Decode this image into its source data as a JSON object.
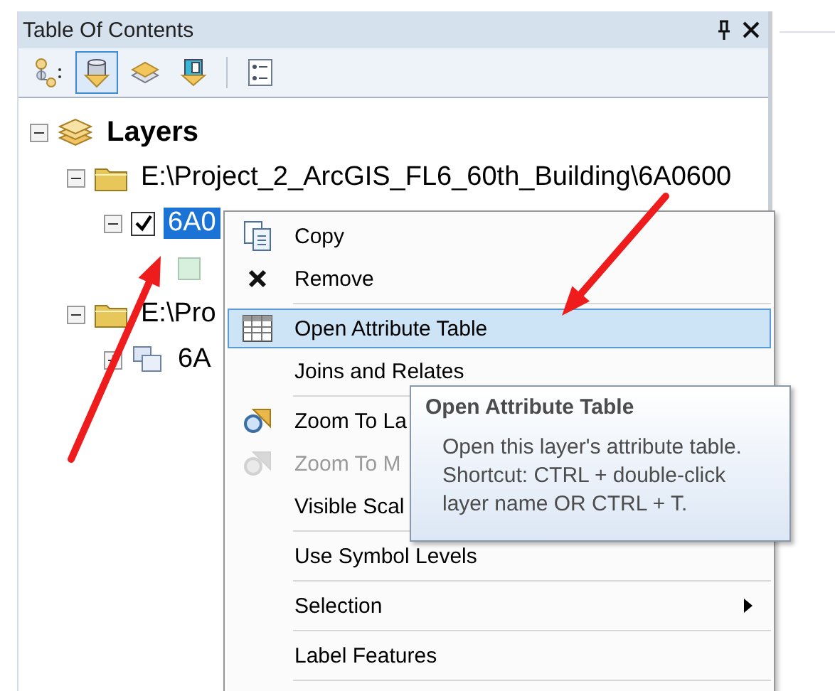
{
  "panel": {
    "title": "Table Of Contents"
  },
  "toolbar": [
    {
      "kind": "drawing-order",
      "selected": false
    },
    {
      "kind": "source",
      "selected": true
    },
    {
      "kind": "visibility",
      "selected": false
    },
    {
      "kind": "selection",
      "selected": false
    },
    {
      "kind": "options",
      "selected": false
    }
  ],
  "tree": [
    {
      "kind": "group",
      "label": "Layers",
      "expanded": true,
      "children": [
        {
          "kind": "folder",
          "label": "E:\\Project_2_ArcGIS_FL6_60th_Building\\6A0600",
          "expanded": true,
          "children": [
            {
              "kind": "layer",
              "label": "6A0",
              "expanded": true,
              "checked": true,
              "selected": true,
              "children": [
                {
                  "kind": "legend"
                }
              ]
            }
          ]
        },
        {
          "kind": "folder",
          "label": "E:\\Pro",
          "expanded": true,
          "children": [
            {
              "kind": "layergroup",
              "label": "6A",
              "expanded": false
            }
          ]
        }
      ]
    }
  ],
  "context_menu": [
    {
      "label": "Copy",
      "kind": "copy",
      "selected": false,
      "disabled": false,
      "submenu": false,
      "separator_after": false
    },
    {
      "label": "Remove",
      "kind": "remove",
      "selected": false,
      "disabled": false,
      "submenu": false,
      "separator_after": true
    },
    {
      "label": "Open Attribute Table",
      "kind": "table",
      "selected": true,
      "disabled": false,
      "submenu": false,
      "separator_after": false
    },
    {
      "label": "Joins and Relates",
      "kind": "plain",
      "selected": false,
      "disabled": false,
      "submenu": false,
      "separator_after": true
    },
    {
      "label": "Zoom To La",
      "kind": "zoom",
      "selected": false,
      "disabled": false,
      "submenu": false,
      "separator_after": false
    },
    {
      "label": "Zoom To M",
      "kind": "zoom",
      "selected": false,
      "disabled": true,
      "submenu": false,
      "separator_after": false
    },
    {
      "label": "Visible Scal",
      "kind": "plain",
      "selected": false,
      "disabled": false,
      "submenu": false,
      "separator_after": true
    },
    {
      "label": "Use Symbol Levels",
      "kind": "plain",
      "selected": false,
      "disabled": false,
      "submenu": false,
      "separator_after": true
    },
    {
      "label": "Selection",
      "kind": "plain",
      "selected": false,
      "disabled": false,
      "submenu": true,
      "separator_after": true
    },
    {
      "label": "Label Features",
      "kind": "plain",
      "selected": false,
      "disabled": false,
      "submenu": false,
      "separator_after": true
    }
  ],
  "tooltip": {
    "title": "Open Attribute Table",
    "lines": [
      "Open this layer's attribute table.",
      "Shortcut: CTRL + double-click",
      "layer name OR CTRL + T."
    ]
  }
}
